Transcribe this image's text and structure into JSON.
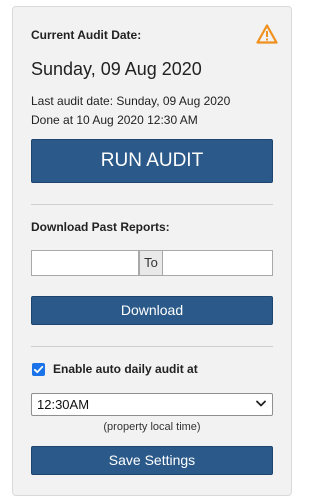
{
  "audit": {
    "current_label": "Current Audit Date:",
    "current_date": "Sunday, 09 Aug 2020",
    "last_audit": "Last audit date: Sunday, 09 Aug 2020",
    "done_at": "Done at 10 Aug 2020 12:30 AM",
    "run_button": "RUN AUDIT",
    "warning_icon": "warning-triangle-icon"
  },
  "reports": {
    "label": "Download Past Reports:",
    "from_value": "",
    "to_label": "To",
    "to_value": "",
    "download_button": "Download"
  },
  "settings": {
    "auto_audit_label": "Enable auto daily audit at",
    "auto_audit_checked": true,
    "time_selected": "12:30AM",
    "time_hint": "(property local time)",
    "save_button": "Save Settings"
  },
  "colors": {
    "primary_button": "#2b5a8a",
    "warning": "#f0901e",
    "checkbox": "#1a73e8",
    "panel_bg": "#f2f2f2"
  }
}
